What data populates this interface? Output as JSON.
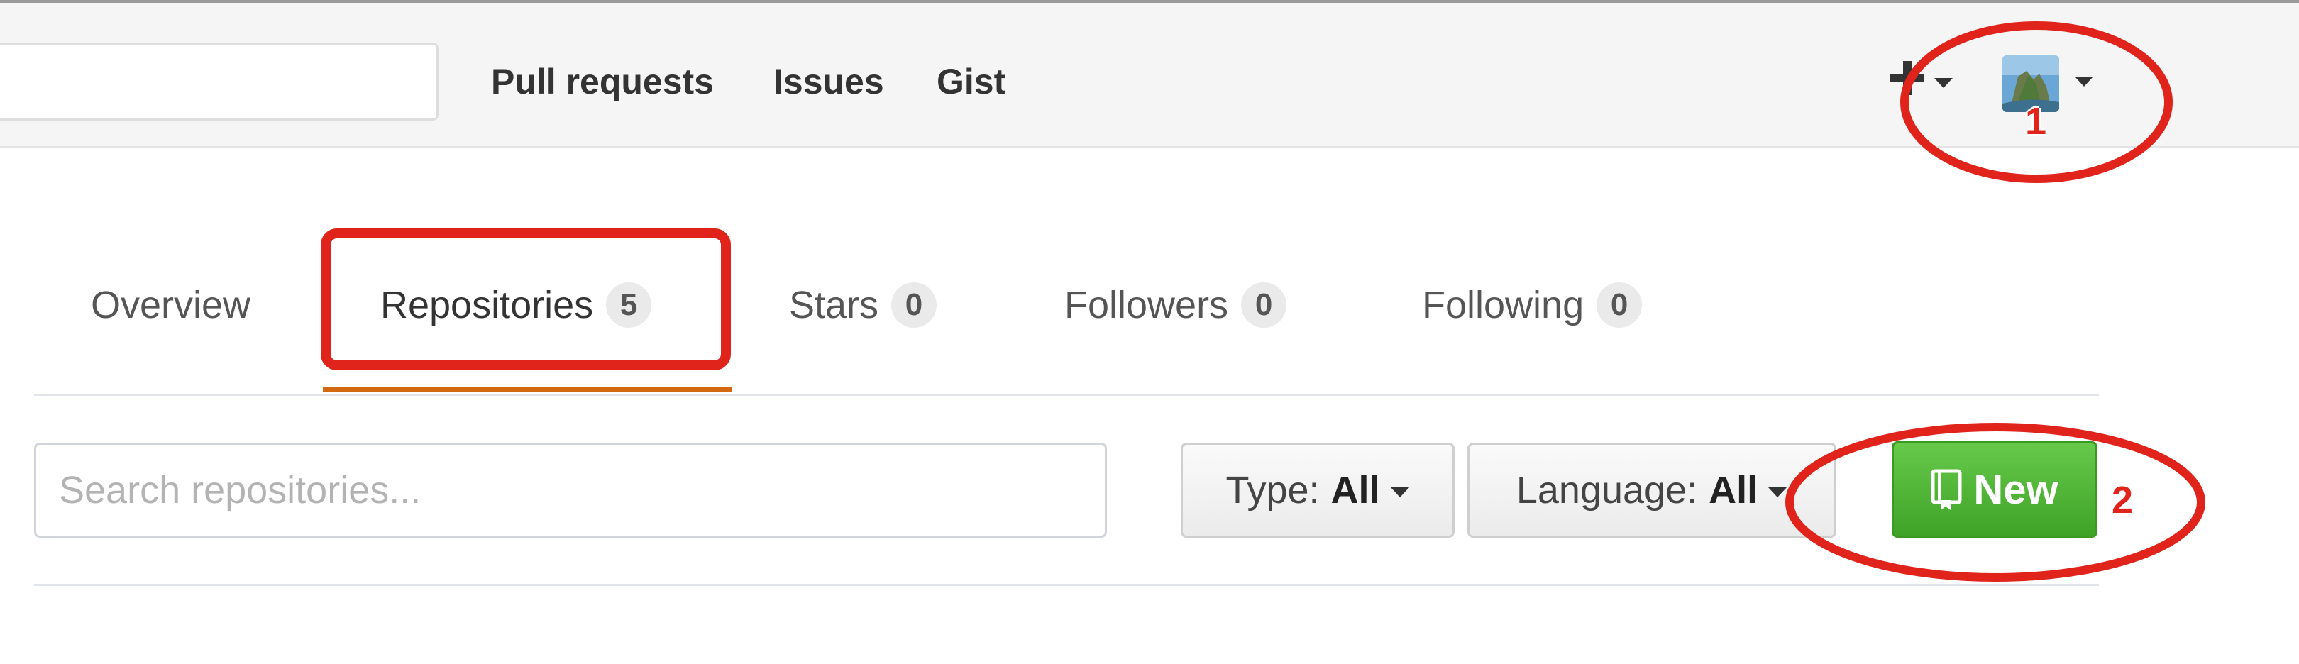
{
  "header": {
    "nav": [
      "Pull requests",
      "Issues",
      "Gist"
    ]
  },
  "tabs": [
    {
      "label": "Overview"
    },
    {
      "label": "Repositories",
      "count": "5"
    },
    {
      "label": "Stars",
      "count": "0"
    },
    {
      "label": "Followers",
      "count": "0"
    },
    {
      "label": "Following",
      "count": "0"
    }
  ],
  "filters": {
    "search_placeholder": "Search repositories...",
    "type_label": "Type:",
    "type_value": "All",
    "language_label": "Language:",
    "language_value": "All",
    "new_label": "New"
  },
  "annotations": {
    "label_1": "1",
    "label_2": "2"
  },
  "colors": {
    "accent": "#d26911",
    "new_button": "#4cb032",
    "annotation": "#e0241b"
  },
  "icons": [
    "plus-icon",
    "avatar",
    "caret-down-icon",
    "repo-icon"
  ]
}
